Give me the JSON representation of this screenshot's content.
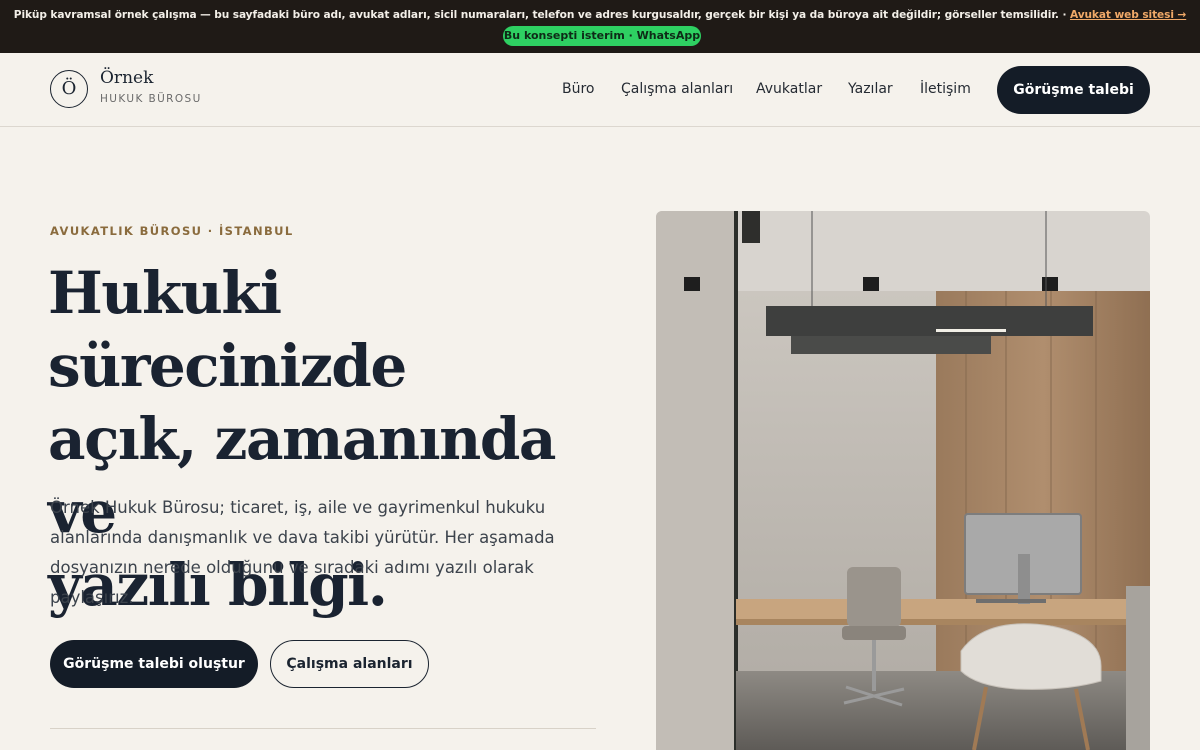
{
  "notice": {
    "text": "Piküp kavramsal örnek çalışma — bu sayfadaki büro adı, avukat adları, sicil numaraları, telefon ve adres kurgusaldır, gerçek bir kişi ya da büroya ait değildir; görseller temsilidir. · ",
    "link": "Avukat web sitesi →",
    "whatsapp": "Bu konsepti isterim · WhatsApp"
  },
  "brand": {
    "mark": "Ö",
    "name": "Örnek",
    "sub": "HUKUK BÜROSU"
  },
  "nav": {
    "items": [
      "Büro",
      "Çalışma alanları",
      "Avukatlar",
      "Yazılar",
      "İletişim"
    ],
    "cta": "Görüşme talebi"
  },
  "hero": {
    "eyebrow": "AVUKATLIK BÜROSU · İSTANBUL",
    "title_lines": [
      "Hukuki sürecinizde",
      "açık, zamanında ve",
      "yazılı bilgi."
    ],
    "body": "Örnek Hukuk Bürosu; ticaret, iş, aile ve gayrimenkul hukuku alanlarında danışmanlık ve dava takibi yürütür. Her aşamada dosyanızın nerede olduğunu ve sıradaki adımı yazılı olarak paylaşırız.",
    "primary_cta": "Görüşme talebi oluştur",
    "secondary_cta": "Çalışma alanları"
  },
  "colors": {
    "background": "#f5f2ec",
    "ink": "#1b2430",
    "accent": "#8a6b3d",
    "notice_bg": "#1f1a16",
    "notice_link": "#f0a968",
    "whatsapp": "#2ed062"
  }
}
